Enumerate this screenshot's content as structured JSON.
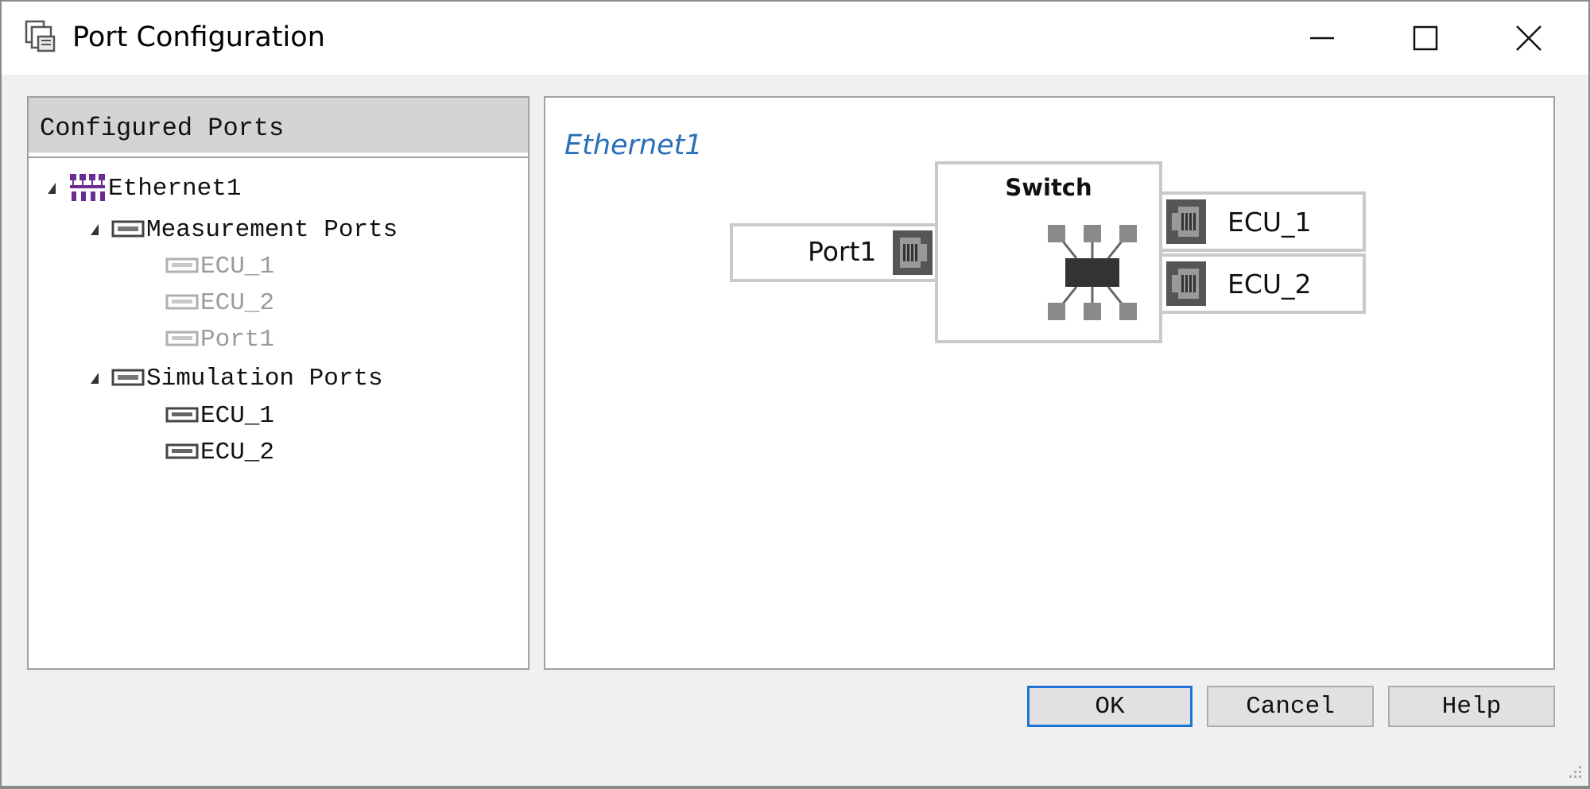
{
  "window": {
    "title": "Port Configuration",
    "minimize_icon": "minimize-icon",
    "maximize_icon": "maximize-icon",
    "close_icon": "close-icon"
  },
  "tree": {
    "header": "Configured Ports",
    "root": {
      "label": "Ethernet1",
      "icon": "ethernet-network-icon"
    },
    "groups": [
      {
        "label": "Measurement Ports",
        "icon": "port-group-icon",
        "items": [
          {
            "label": "ECU_1",
            "enabled": false
          },
          {
            "label": "ECU_2",
            "enabled": false
          },
          {
            "label": "Port1",
            "enabled": false
          }
        ]
      },
      {
        "label": "Simulation Ports",
        "icon": "port-group-icon",
        "items": [
          {
            "label": "ECU_1",
            "enabled": true
          },
          {
            "label": "ECU_2",
            "enabled": true
          }
        ]
      }
    ]
  },
  "diagram": {
    "network_name": "Ethernet1",
    "switch_label": "Switch",
    "left_port": "Port1",
    "right_ports": [
      "ECU_1",
      "ECU_2"
    ],
    "port_icon": "ethernet-jack-icon",
    "switch_icon": "network-switch-icon"
  },
  "buttons": {
    "ok": "OK",
    "cancel": "Cancel",
    "help": "Help"
  },
  "colors": {
    "accent": "#1e74d2",
    "network_title": "#2a6fb8",
    "network_icon": "#6b2c91"
  }
}
